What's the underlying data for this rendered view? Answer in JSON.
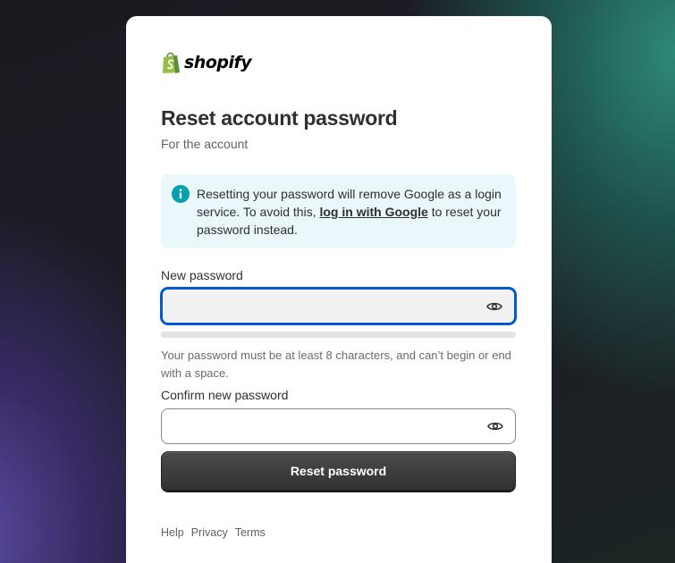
{
  "logo": {
    "text": "shopify",
    "icon": "shopify-bag-icon",
    "brand_color": "#95bf47"
  },
  "heading": {
    "title": "Reset account password",
    "subtitle": "For the account"
  },
  "notice": {
    "icon": "info-icon",
    "text_before": "Resetting your password will remove Google as a login service. To avoid this, ",
    "link_label": "log in with Google",
    "text_after": " to reset your password instead.",
    "icon_color": "#00a0ac",
    "background": "#eaf7fb"
  },
  "new_password": {
    "label": "New password",
    "value": "",
    "toggle_icon": "eye-icon",
    "strength": 0
  },
  "password_hint": "Your password must be at least 8 characters, and can’t begin or end with a space.",
  "confirm_password": {
    "label": "Confirm new password",
    "value": "",
    "toggle_icon": "eye-icon"
  },
  "submit_label": "Reset password",
  "footer_links": [
    "Help",
    "Privacy",
    "Terms"
  ],
  "colors": {
    "focus": "#005bd3",
    "button": "#303030"
  }
}
